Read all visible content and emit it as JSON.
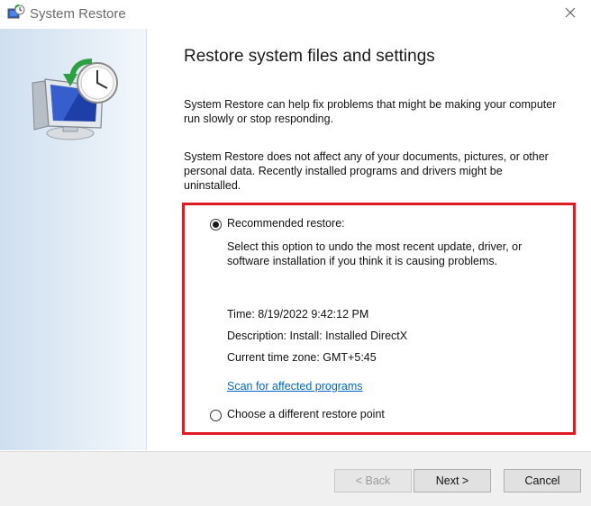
{
  "window": {
    "title": "System Restore",
    "app_icon": "system-restore-icon",
    "close_icon": "close-icon"
  },
  "sidebar": {
    "illustration": "monitor-with-clock-icon"
  },
  "main": {
    "heading": "Restore system files and settings",
    "paragraph_1": "System Restore can help fix problems that might be making your computer run slowly or stop responding.",
    "paragraph_2": "System Restore does not affect any of your documents, pictures, or other personal data. Recently installed programs and drivers might be uninstalled."
  },
  "options": {
    "recommended": {
      "label": "Recommended restore:",
      "selected": true,
      "description": "Select this option to undo the most recent update, driver, or software installation if you think it is causing problems.",
      "time": "Time: 8/19/2022 9:42:12 PM",
      "description_detail": "Description: Install: Installed DirectX",
      "timezone": "Current time zone: GMT+5:45",
      "scan_link": "Scan for affected programs"
    },
    "different": {
      "label": "Choose a different restore point",
      "selected": false
    },
    "highlight_color": "#e01b24"
  },
  "footer": {
    "back_label": "< Back",
    "back_enabled": false,
    "next_label": "Next >",
    "cancel_label": "Cancel"
  },
  "colors": {
    "link": "#0066cc",
    "sidebar_gradient_start": "#cfdff0",
    "footer_bg": "#f0f0f0"
  }
}
